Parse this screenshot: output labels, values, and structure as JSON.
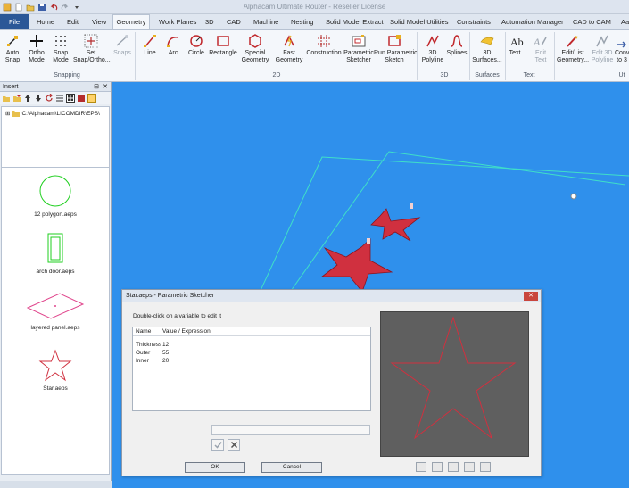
{
  "window": {
    "title": "Alphacam Ultimate Router - Reseller License"
  },
  "tabs": [
    "File",
    "Home",
    "Edit",
    "View",
    "Geometry",
    "Work Planes",
    "3D",
    "CAD",
    "Machine",
    "Nesting",
    "Solid Model Extract",
    "Solid Model Utilities",
    "Constraints",
    "Automation Manager",
    "CAD to CAM",
    "Aa"
  ],
  "ribbon": {
    "snapping": {
      "auto_snap": "Auto\nSnap",
      "ortho_mode": "Ortho\nMode",
      "snap_mode": "Snap\nMode",
      "set_snap": "Set\nSnap/Ortho...",
      "snaps": "Snaps",
      "group": "Snapping"
    },
    "two_d": {
      "line": "Line",
      "arc": "Arc",
      "circle": "Circle",
      "rectangle": "Rectangle",
      "special": "Special\nGeometry",
      "fast": "Fast\nGeometry",
      "construction": "Construction",
      "param_sketcher": "Parametric\nSketcher",
      "run_param": "Run Parametric\nSketch",
      "group": "2D"
    },
    "three_d": {
      "polyline": "3D\nPolyline",
      "splines": "Splines",
      "group": "3D"
    },
    "surfaces": {
      "surfaces3d": "3D\nSurfaces...",
      "group": "Surfaces"
    },
    "text": {
      "text": "Text...",
      "edit_text": "Edit\nText",
      "group": "Text"
    },
    "util": {
      "edit_list": "Edit/List\nGeometry...",
      "edit3d": "Edit 3D\nPolyline",
      "conv": "Conv\nto 3",
      "group": "Ut"
    }
  },
  "insert_panel": {
    "title": "Insert",
    "path": "C:\\Alphacam\\LICOMDIR\\EPS\\",
    "items": [
      "12 polygon.aeps",
      "arch door.aeps",
      "layered panel.aeps",
      "Star.aeps"
    ]
  },
  "dialog": {
    "title": "Star.aeps - Parametric Sketcher",
    "hint": "Double-click on a variable to edit it",
    "col_name": "Name",
    "col_value": "Value / Expression",
    "rows": [
      {
        "name": "Thickness",
        "value": "12"
      },
      {
        "name": "Outer",
        "value": "55"
      },
      {
        "name": "Inner",
        "value": "20"
      }
    ],
    "ok": "OK",
    "cancel": "Cancel"
  },
  "colors": {
    "canvas": "#2f90ec",
    "file_tab": "#2b5797",
    "outline": "#3fe0c8",
    "star": "#d0303f"
  }
}
